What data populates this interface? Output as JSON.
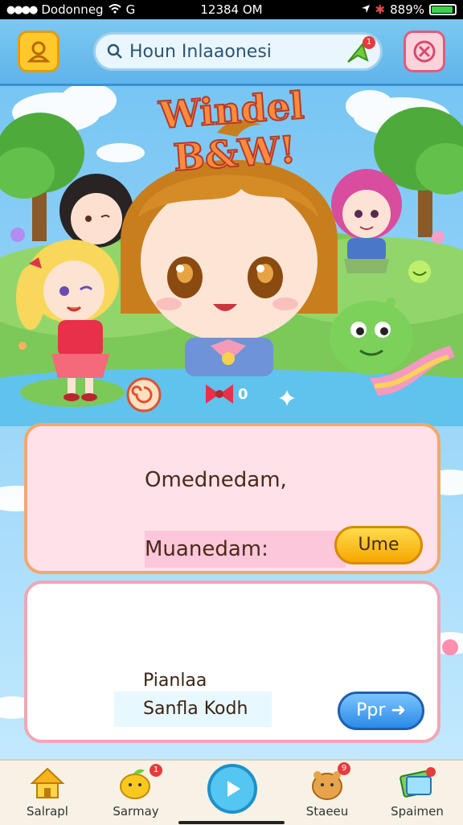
{
  "status_bar": {
    "carrier": "Dodonneg",
    "network": "G",
    "time": "12384 OM",
    "battery": "889%"
  },
  "top_bar": {
    "search_text": "Houn Inlaaonesi",
    "search_badge": "1",
    "icons": {
      "left": "avatar-icon",
      "search": "search-icon",
      "go": "send-icon",
      "right": "close-icon"
    }
  },
  "title": "Windel B&W!",
  "scene": {
    "pet_indicator": "0",
    "icons": [
      "swirl-icon",
      "bow-icon",
      "sparkle-icon"
    ]
  },
  "card_one": {
    "line1": "Omednedam,",
    "line2": "Muanedam:",
    "button": "Ume"
  },
  "card_two": {
    "line1": "Pianlaa",
    "line2": "Sanfla Kodh",
    "button": "Ppr"
  },
  "bottom_nav": [
    {
      "label": "Salrapl",
      "icon": "home-icon"
    },
    {
      "label": "Sarmay",
      "icon": "fruit-icon",
      "badge": "1"
    },
    {
      "label": "",
      "icon": "play-icon"
    },
    {
      "label": "Staeeu",
      "icon": "pet-icon",
      "badge": "9"
    },
    {
      "label": "Spaimen",
      "icon": "card-icon"
    }
  ],
  "colors": {
    "accent_yellow": "#ffc92b",
    "accent_pink": "#f0a7b6",
    "accent_blue": "#54c6f1",
    "sky": "#8fd0f5",
    "grass": "#7cc859"
  }
}
